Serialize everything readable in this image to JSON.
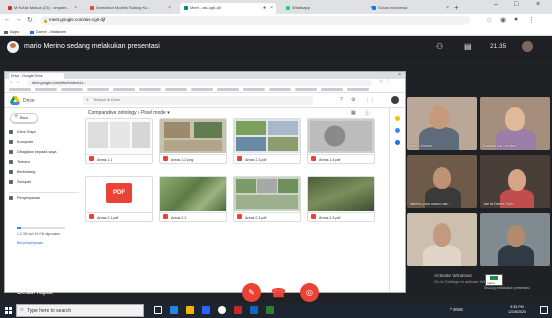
{
  "browser": {
    "tabs": [
      {
        "label": "M  Kotak Masuk (23) - smpahi...",
        "fav_color": "#d93025"
      },
      {
        "label": "Animation Models Sidang Ku...",
        "fav_color": "#e8453c"
      },
      {
        "label": "Meet - ais-cgit-djf",
        "fav_color": "#00897b"
      },
      {
        "label": "Whatsapp",
        "fav_color": "#25d366"
      },
      {
        "label": "Solusi Indonesia",
        "fav_color": "#1a73e8"
      }
    ],
    "new_tab": "+",
    "window_controls": [
      "–",
      "□",
      "×"
    ],
    "url": "meet.google.com/ais-cgit-djf",
    "bookmarks": [
      "Apps",
      "Dome - Mataram"
    ]
  },
  "meet": {
    "presenting_text": "mario Merino sedang melakukan presentasi",
    "time": "21.35",
    "participants": [
      {
        "name": "mario Merino"
      },
      {
        "name": "Kabaria Lan berdan"
      },
      {
        "name": "alberto pulo rosmo wa..."
      },
      {
        "name": "Jue la Dema Eplo..."
      },
      {
        "name": ""
      },
      {
        "name": ""
      }
    ],
    "details_label": "Detail rapat",
    "details_chevron": "^",
    "activate_title": "Activate Windows",
    "activate_sub": "Go to Settings to activate Windows.",
    "presenting_note": "Sedang melakukan presentasi",
    "tooltip_text": "mario (Anda) ..."
  },
  "shared": {
    "tab_title": "Drive - Google Drive",
    "url": "drive.google.com/drive/folders/1x...",
    "drive_title": "Drive",
    "search_placeholder": "Telusuri di Drive",
    "new_button": "Baru",
    "sidebar": [
      "Drive Saya",
      "Komputer",
      "Dibagikan kepada saya",
      "Terbaru",
      "Berbintang",
      "Sampah"
    ],
    "storage_label": "Penyimpanan",
    "storage_used": "1,2 GB dari 15 GB digunakan",
    "storage_fraction": 0.08,
    "buy_storage": "Beli penyimpanan",
    "breadcrumb": "Comparative ontology  ›  Pixel mode  ▾",
    "files": [
      "Areas 1.1",
      "Areas 1.2.png",
      "Areas 1.3.pdf",
      "Areas 1.4.pdf",
      "Areas 2.1.pdf",
      "Areas 2.2",
      "Areas 2.3.pdf",
      "Areas 2.4.pdf"
    ],
    "pdf_label": "PDF"
  },
  "taskbar": {
    "search_placeholder": "Type here to search",
    "tray": "^  ENG",
    "time": "9:35 PM",
    "date": "12/28/2020"
  },
  "colors": {
    "meet_bg": "#202124",
    "accent_red": "#ea4335",
    "drive_blue": "#4285f4"
  }
}
